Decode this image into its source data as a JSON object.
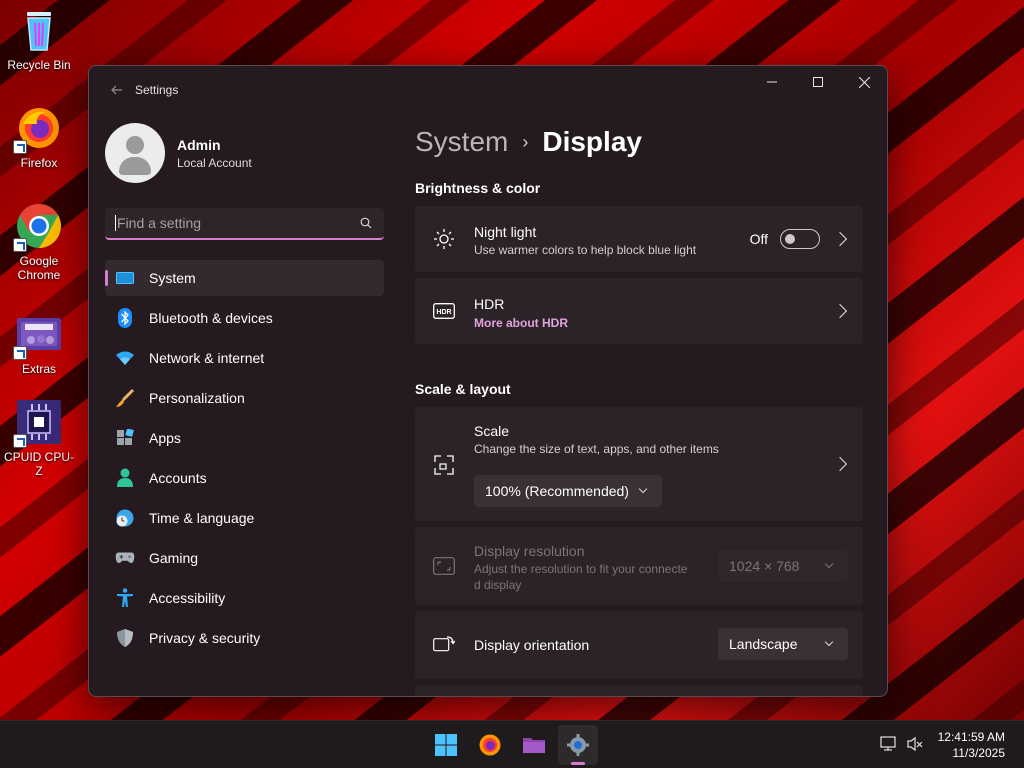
{
  "desktop": {
    "icons": [
      {
        "label": "Recycle Bin",
        "icon": "recycle-bin-icon"
      },
      {
        "label": "Firefox",
        "icon": "firefox-icon"
      },
      {
        "label": "Google Chrome",
        "icon": "chrome-icon"
      },
      {
        "label": "Extras",
        "icon": "fortnite-folder-icon"
      },
      {
        "label": "CPUID CPU-Z",
        "icon": "cpu-z-icon"
      }
    ]
  },
  "window": {
    "title": "Settings",
    "controls": [
      "minimize",
      "maximize",
      "close"
    ]
  },
  "sidebar": {
    "user_name": "Admin",
    "user_account": "Local Account",
    "search_placeholder": "Find a setting",
    "items": [
      {
        "label": "System",
        "icon": "monitor-icon",
        "active": true
      },
      {
        "label": "Bluetooth & devices",
        "icon": "bluetooth-icon"
      },
      {
        "label": "Network & internet",
        "icon": "wifi-icon"
      },
      {
        "label": "Personalization",
        "icon": "brush-icon"
      },
      {
        "label": "Apps",
        "icon": "apps-icon"
      },
      {
        "label": "Accounts",
        "icon": "person-icon"
      },
      {
        "label": "Time & language",
        "icon": "clock-globe-icon"
      },
      {
        "label": "Gaming",
        "icon": "gamepad-icon"
      },
      {
        "label": "Accessibility",
        "icon": "accessibility-icon"
      },
      {
        "label": "Privacy & security",
        "icon": "shield-icon"
      }
    ]
  },
  "main": {
    "breadcrumb_parent": "System",
    "breadcrumb_current": "Display",
    "brightness_section": "Brightness & color",
    "night_light": {
      "title": "Night light",
      "subtitle": "Use warmer colors to help block blue light",
      "state": "Off"
    },
    "hdr": {
      "title": "HDR",
      "link": "More about HDR"
    },
    "scale_section": "Scale & layout",
    "scale": {
      "title": "Scale",
      "subtitle": "Change the size of text, apps, and other items",
      "value": "100% (Recommended)"
    },
    "resolution": {
      "title": "Display resolution",
      "subtitle_line1": "Adjust the resolution to fit your connecte",
      "subtitle_line2": "d display",
      "value": "1024 × 768"
    },
    "orientation": {
      "title": "Display orientation",
      "value": "Landscape"
    }
  },
  "taskbar": {
    "apps": [
      "start-icon",
      "firefox-icon",
      "file-explorer-icon",
      "settings-icon"
    ],
    "time": "12:41:59 AM",
    "date": "11/3/2025"
  },
  "colors": {
    "accent": "#d67fd0",
    "window_bg": "#241a1f",
    "card_bg": "#2c2328"
  }
}
